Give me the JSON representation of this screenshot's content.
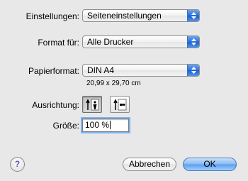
{
  "settings": {
    "label": "Einstellungen:",
    "value": "Seiteneinstellungen"
  },
  "format_for": {
    "label": "Format für:",
    "value": "Alle Drucker"
  },
  "paper": {
    "label": "Papierformat:",
    "value": "DIN A4",
    "size_text": "20,99 x 29,70 cm"
  },
  "orientation": {
    "label": "Ausrichtung:",
    "selected": "portrait"
  },
  "scale": {
    "label": "Größe:",
    "value": "100 %"
  },
  "buttons": {
    "help": "?",
    "cancel": "Abbrechen",
    "ok": "OK"
  },
  "colors": {
    "accent": "#2e6fd8",
    "background": "#e8e8e8"
  }
}
